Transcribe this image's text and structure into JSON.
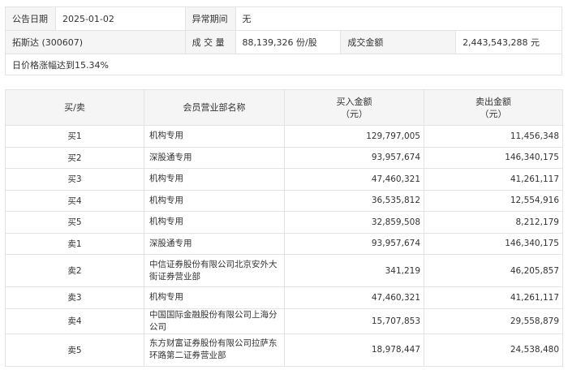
{
  "info": {
    "announce_date_label": "公告日期",
    "announce_date_value": "2025-01-02",
    "abnormal_period_label": "异常期间",
    "abnormal_period_value": "无",
    "stock_name": "拓斯达 (300607)",
    "volume_label": "成 交 量",
    "volume_value": "88,139,326 份/股",
    "amount_label": "成交金额",
    "amount_value": "2,443,543,288 元",
    "reason": "日价格涨幅达到15.34%"
  },
  "table": {
    "headers": {
      "side": "买/卖",
      "broker": "会员营业部名称",
      "buy_amount_1": "买入金额",
      "buy_amount_2": "（元）",
      "sell_amount_1": "卖出金额",
      "sell_amount_2": "（元）"
    },
    "rows": [
      {
        "side": "买1",
        "broker": "机构专用",
        "buy": "129,797,005",
        "sell": "11,456,348"
      },
      {
        "side": "买2",
        "broker": "深股通专用",
        "buy": "93,957,674",
        "sell": "146,340,175"
      },
      {
        "side": "买3",
        "broker": "机构专用",
        "buy": "47,460,321",
        "sell": "41,261,117"
      },
      {
        "side": "买4",
        "broker": "机构专用",
        "buy": "36,535,812",
        "sell": "12,554,916"
      },
      {
        "side": "买5",
        "broker": "机构专用",
        "buy": "32,859,508",
        "sell": "8,212,179"
      },
      {
        "side": "卖1",
        "broker": "深股通专用",
        "buy": "93,957,674",
        "sell": "146,340,175"
      },
      {
        "side": "卖2",
        "broker": "中信证券股份有限公司北京安外大街证券营业部",
        "buy": "341,219",
        "sell": "46,205,857"
      },
      {
        "side": "卖3",
        "broker": "机构专用",
        "buy": "47,460,321",
        "sell": "41,261,117"
      },
      {
        "side": "卖4",
        "broker": "中国国际金融股份有限公司上海分公司",
        "buy": "15,707,853",
        "sell": "29,558,879"
      },
      {
        "side": "卖5",
        "broker": "东方财富证券股份有限公司拉萨东环路第二证券营业部",
        "buy": "18,978,447",
        "sell": "24,538,480"
      }
    ]
  }
}
